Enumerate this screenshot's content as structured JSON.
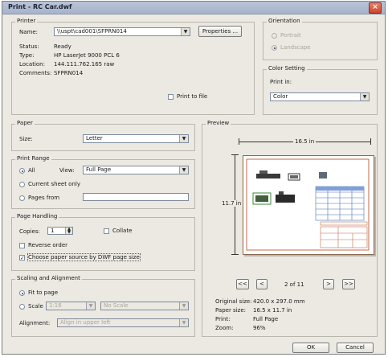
{
  "window": {
    "title": "Print - RC Car.dwf",
    "close_glyph": "×"
  },
  "printer": {
    "group_label": "Printer",
    "name_label": "Name:",
    "name_value": "\\\\uspt\\cad001\\SFPRN014",
    "properties_label": "Properties ...",
    "status_label": "Status:",
    "status_value": "Ready",
    "type_label": "Type:",
    "type_value": "HP LaserJet 9000 PCL 6",
    "location_label": "Location:",
    "location_value": "144.111.762.165 raw",
    "comments_label": "Comments:",
    "comments_value": "SFPRN014",
    "print_to_file_label": "Print to file",
    "print_to_file_checked": false
  },
  "orientation": {
    "group_label": "Orientation",
    "options": [
      {
        "label": "Portrait",
        "selected": false,
        "enabled": false
      },
      {
        "label": "Landscape",
        "selected": true,
        "enabled": false
      }
    ]
  },
  "color_setting": {
    "group_label": "Color Setting",
    "print_in_label": "Print in:",
    "print_in_value": "Color"
  },
  "paper": {
    "group_label": "Paper",
    "size_label": "Size:",
    "size_value": "Letter"
  },
  "print_range": {
    "group_label": "Print Range",
    "all_label": "All",
    "all_selected": true,
    "view_label": "View:",
    "view_value": "Full Page",
    "current_sheet_label": "Current sheet only",
    "pages_label": "Pages from",
    "pages_value": ""
  },
  "page_handling": {
    "group_label": "Page Handling",
    "copies_label": "Copies:",
    "copies_value": "1",
    "collate_label": "Collate",
    "collate_checked": false,
    "reverse_order_label": "Reverse order",
    "reverse_order_checked": false,
    "choose_source_label": "Choose paper source by DWF page size",
    "choose_source_checked": true
  },
  "scaling": {
    "group_label": "Scaling and Alignment",
    "fit_label": "Fit to page",
    "fit_selected": true,
    "scale_label": "Scale",
    "scale_value": "1:16",
    "scale_units": "No Scale",
    "alignment_label": "Alignment:",
    "alignment_value": "Align in upper left"
  },
  "preview": {
    "group_label": "Preview",
    "width_dim": "16.5 in",
    "height_dim": "11.7 in",
    "nav": {
      "first": "<<",
      "prev": "<",
      "page": "2 of 11",
      "next": ">",
      "last": ">>"
    },
    "info": [
      {
        "label": "Original size:",
        "value": "420.0 x 297.0 mm"
      },
      {
        "label": "Paper size:",
        "value": "16.5 x 11.7 in"
      },
      {
        "label": "Print:",
        "value": "Full Page"
      },
      {
        "label": "Zoom:",
        "value": "96%"
      }
    ]
  },
  "buttons": {
    "ok": "OK",
    "cancel": "Cancel"
  }
}
